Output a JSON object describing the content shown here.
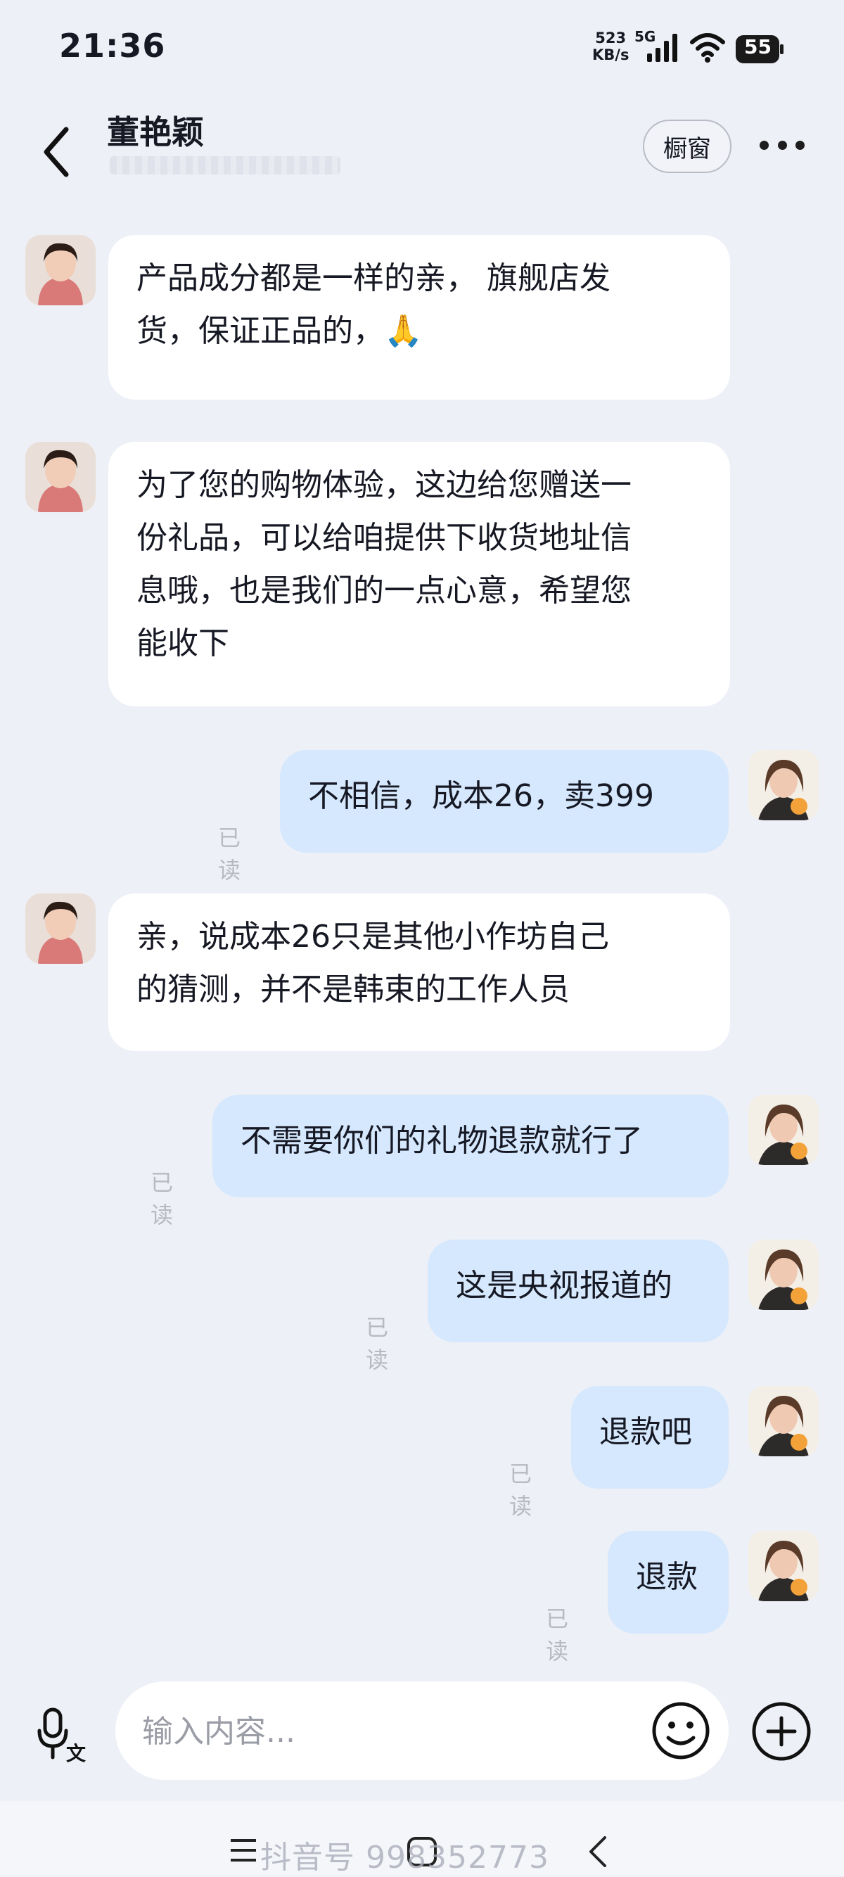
{
  "status": {
    "time": "21:36",
    "net_speed_value": "523",
    "net_speed_unit": "KB/s",
    "network": "5G",
    "battery": "55"
  },
  "header": {
    "contact_name": "董艳颖",
    "shop_button": "橱窗",
    "back_icon": "chevron-left-icon",
    "more_icon": "more-dots-icon"
  },
  "messages": [
    {
      "side": "left",
      "lines": [
        "产品成分都是一样的亲， 旗舰店发",
        "货，保证正品的，🙏"
      ]
    },
    {
      "side": "left",
      "lines": [
        "为了您的购物体验，这边给您赠送一",
        "份礼品，可以给咱提供下收货地址信",
        "息哦，也是我们的一点心意，希望您",
        "能收下"
      ]
    },
    {
      "side": "right",
      "text": "不相信，成本26，卖399",
      "status": "已读"
    },
    {
      "side": "left",
      "lines": [
        "亲，说成本26只是其他小作坊自己",
        "的猜测，并不是韩束的工作人员"
      ]
    },
    {
      "side": "right",
      "text": "不需要你们的礼物退款就行了",
      "status": "已读"
    },
    {
      "side": "right",
      "text": "这是央视报道的",
      "status": "已读"
    },
    {
      "side": "right",
      "text": "退款吧",
      "status": "已读"
    },
    {
      "side": "right",
      "text": "退款",
      "status": "已读"
    }
  ],
  "input": {
    "placeholder": "输入内容...",
    "voice_icon": "voice-text-icon",
    "emoji_icon": "emoji-icon",
    "plus_icon": "plus-circle-icon"
  },
  "nav": {
    "watermark": "抖音号 998352773"
  }
}
